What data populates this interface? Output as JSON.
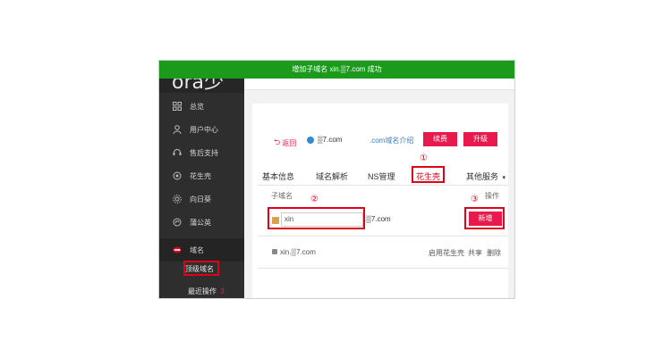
{
  "banner": {
    "message": "增加子域名 xin.▒7.com 成功"
  },
  "sidebar": {
    "logo": "ora少",
    "items": [
      {
        "label": "总览",
        "icon": "grid-icon"
      },
      {
        "label": "用户中心",
        "icon": "user-icon"
      },
      {
        "label": "售后支持",
        "icon": "support-icon"
      },
      {
        "label": "花生壳",
        "icon": "peanut-icon"
      },
      {
        "label": "向日葵",
        "icon": "sunflower-icon"
      },
      {
        "label": "蒲公英",
        "icon": "dandelion-icon"
      },
      {
        "label": "域名",
        "icon": "domain-icon"
      }
    ],
    "sub_items": [
      {
        "label": "顶级域名"
      },
      {
        "label": "最近操作",
        "badge": "3"
      }
    ]
  },
  "header": {
    "back_label": "返回",
    "domain": "▒7.com",
    "intro_link": ".com域名介绍",
    "renew_label": "续费",
    "upgrade_label": "升级"
  },
  "tabs": [
    {
      "label": "基本信息"
    },
    {
      "label": "域名解析"
    },
    {
      "label": "NS管理"
    },
    {
      "label": "花生壳"
    },
    {
      "label": "其他服务"
    }
  ],
  "table": {
    "col_subdomain": "子域名",
    "col_action": "操作",
    "input_value": "xin",
    "suffix": ".▒7.com",
    "add_label": "新增",
    "row_domain": "xin.▒7.com",
    "row_actions": [
      "启用花生壳",
      "共享",
      "删除"
    ]
  },
  "markers": [
    "①",
    "②",
    "③"
  ],
  "colors": {
    "banner": "#1b9a1b",
    "accent": "#e8194c",
    "highlight": "#e0001a",
    "sidebar": "#2e2e2e"
  }
}
